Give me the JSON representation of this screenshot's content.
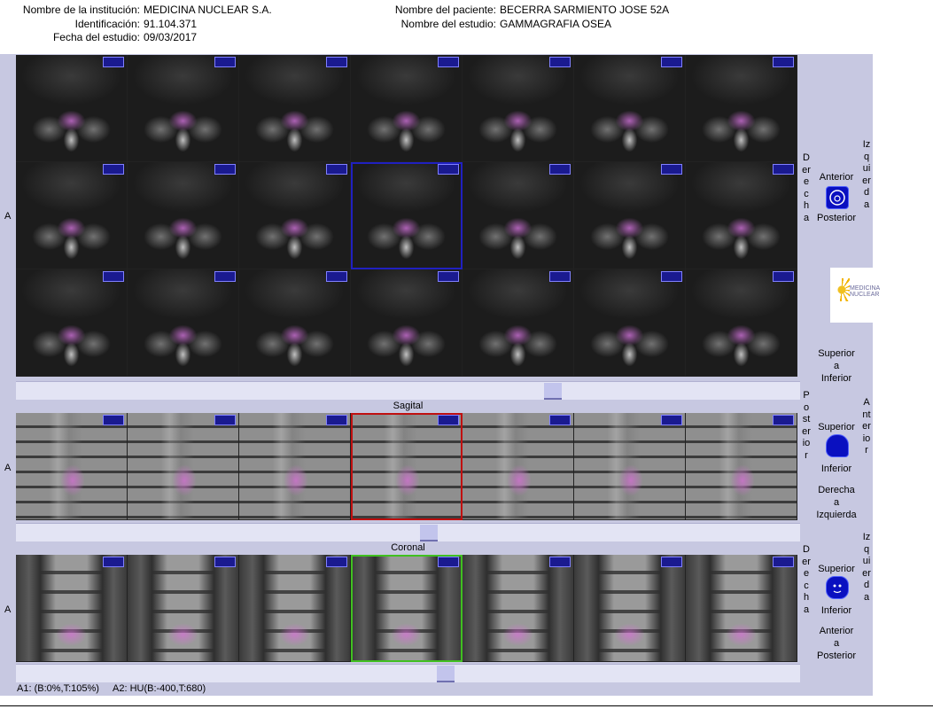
{
  "header": {
    "institution_label": "Nombre de la institución:",
    "institution_value": "MEDICINA NUCLEAR S.A.",
    "id_label": "Identificación:",
    "id_value": "91.104.371",
    "date_label": "Fecha del estudio:",
    "date_value": "09/03/2017",
    "patient_label": "Nombre del paciente:",
    "patient_value": "BECERRA SARMIENTO JOSE 52A",
    "study_label": "Nombre del estudio:",
    "study_value": "GAMMAGRAFIA OSEA"
  },
  "side_label": "A",
  "axial": {
    "left_orient": "Derecha",
    "right_orient": "Izquierda",
    "top_label": "Anterior",
    "bottom_label": "Posterior",
    "icon": "axial-head-icon"
  },
  "superior_inferior": {
    "line1": "Superior",
    "line2": "a",
    "line3": "Inferior"
  },
  "sagittal": {
    "title": "Sagital",
    "left_orient": "Posterior",
    "right_orient": "Anterior",
    "top_label": "Superior",
    "bottom_label": "Inferior",
    "dir_line1": "Derecha",
    "dir_line2": "a",
    "dir_line3": "Izquierda",
    "icon": "sagittal-head-icon"
  },
  "coronal": {
    "title": "Coronal",
    "left_orient": "Derecha",
    "right_orient": "Izquierda",
    "top_label": "Superior",
    "bottom_label": "Inferior",
    "dir_line1": "Anterior",
    "dir_line2": "a",
    "dir_line3": "Posterior",
    "icon": "coronal-head-icon"
  },
  "logo": {
    "line1": "MEDICINA",
    "line2": "NUCLEAR"
  },
  "footer": {
    "a1": "A1: (B:0%,T:105%)",
    "a2": "A2: HU(B:-400,T:680)"
  },
  "colors": {
    "panel_bg": "#c7c8e1",
    "axial_cursor": "#2020c0",
    "sagittal_cursor": "#c01010",
    "coronal_cursor": "#40c020"
  }
}
